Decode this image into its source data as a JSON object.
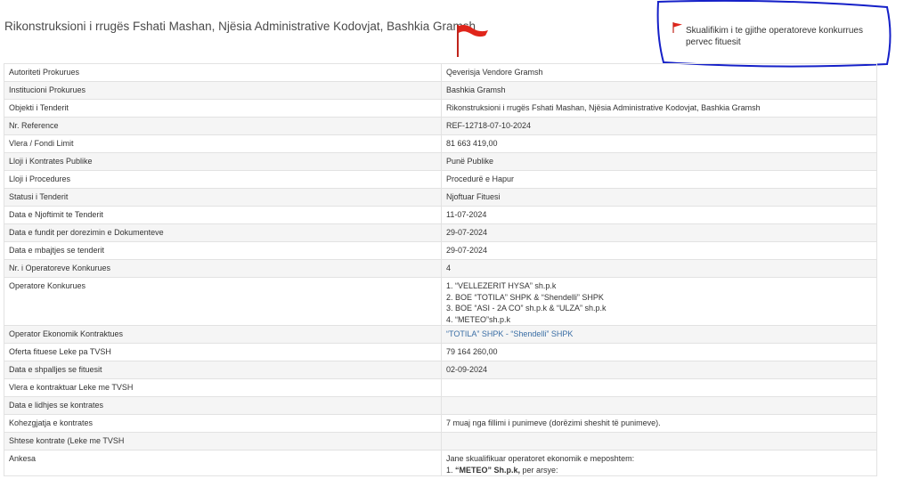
{
  "header": {
    "title": "Rikonstruksioni i rrugës Fshati Mashan, Njësia Administrative Kodovjat, Bashkia Gramsh",
    "note": {
      "line1": "Skualifikim i te gjithe operatoreve konkurrues",
      "line2": "pervec fituesit"
    }
  },
  "colors": {
    "flag_red": "#e0251b",
    "annotation_blue": "#1520c8",
    "link": "#3a6ea5",
    "row_alt": "#f5f5f5"
  },
  "rows": [
    {
      "key": "Autoriteti Prokurues",
      "value": "Qeverisja Vendore Gramsh"
    },
    {
      "key": "Institucioni Prokurues",
      "value": "Bashkia Gramsh"
    },
    {
      "key": "Objekti i Tenderit",
      "value": "Rikonstruksioni i rrugës Fshati Mashan, Njësia Administrative Kodovjat, Bashkia Gramsh"
    },
    {
      "key": "Nr. Reference",
      "value": "REF-12718-07-10-2024"
    },
    {
      "key": "Vlera / Fondi Limit",
      "value": "81 663 419,00"
    },
    {
      "key": "Lloji i Kontrates Publike",
      "value": "Punë Publike"
    },
    {
      "key": "Lloji i Procedures",
      "value": "Procedurë e Hapur"
    },
    {
      "key": "Statusi i Tenderit",
      "value": "Njoftuar Fituesi"
    },
    {
      "key": "Data e Njoftimit te Tenderit",
      "value": "11-07-2024"
    },
    {
      "key": "Data e fundit per dorezimin e Dokumenteve",
      "value": "29-07-2024"
    },
    {
      "key": "Data e mbajtjes se tenderit",
      "value": "29-07-2024"
    },
    {
      "key": "Nr. i Operatoreve Konkurues",
      "value": "4"
    }
  ],
  "operators": {
    "key": "Operatore Konkurues",
    "lines": [
      "1. “VELLEZERIT HYSA” sh.p.k",
      "2. BOE “TOTILA” SHPK & “Shendelli” SHPK",
      "3. BOE “ASI - 2A CO” sh.p.k & “ULZA” sh.p.k",
      "4. “METEO”sh.p.k"
    ]
  },
  "rows2": [
    {
      "key": "Operator Ekonomik Kontraktues",
      "value": "“TOTILA” SHPK - “Shendelli” SHPK"
    },
    {
      "key": "Oferta fituese Leke pa TVSH",
      "value": "79 164 260,00"
    },
    {
      "key": "Data e shpalljes se fituesit",
      "value": "02-09-2024"
    },
    {
      "key": "Vlera e kontraktuar Leke me TVSH",
      "value": ""
    },
    {
      "key": "Data e lidhjes se kontrates",
      "value": ""
    },
    {
      "key": "Kohezgjatja e kontrates",
      "value": "7 muaj nga fillimi i punimeve (dorëzimi sheshit të punimeve)."
    },
    {
      "key": "Shtese kontrate (Leke me TVSH",
      "value": ""
    }
  ],
  "ankesa": {
    "key": "Ankesa",
    "line1": "Jane skualifikuar operatoret ekonomik e meposhtem:",
    "line2_prefix": "1. ",
    "line2_bold": "“METEO” Sh.p.k,",
    "line2_rest": " per arsye:"
  }
}
